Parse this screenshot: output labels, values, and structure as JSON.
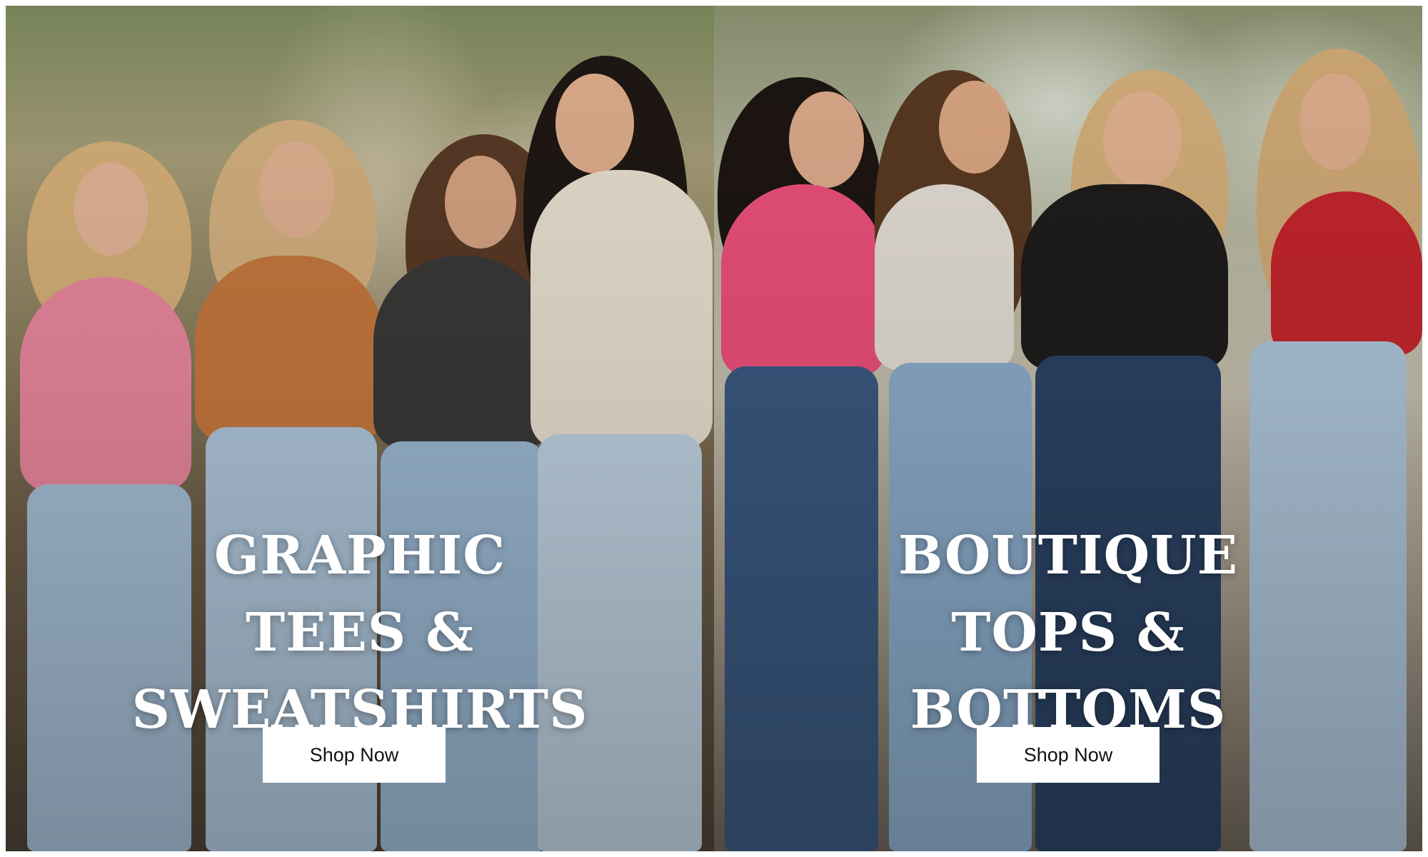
{
  "banners": [
    {
      "headline": [
        "GRAPHIC",
        "TEES &",
        "SWEATSHIRTS"
      ],
      "button_label": "Shop Now"
    },
    {
      "headline": [
        "BOUTIQUE",
        "TOPS &",
        "BOTTOMS"
      ],
      "button_label": "Shop Now"
    }
  ]
}
